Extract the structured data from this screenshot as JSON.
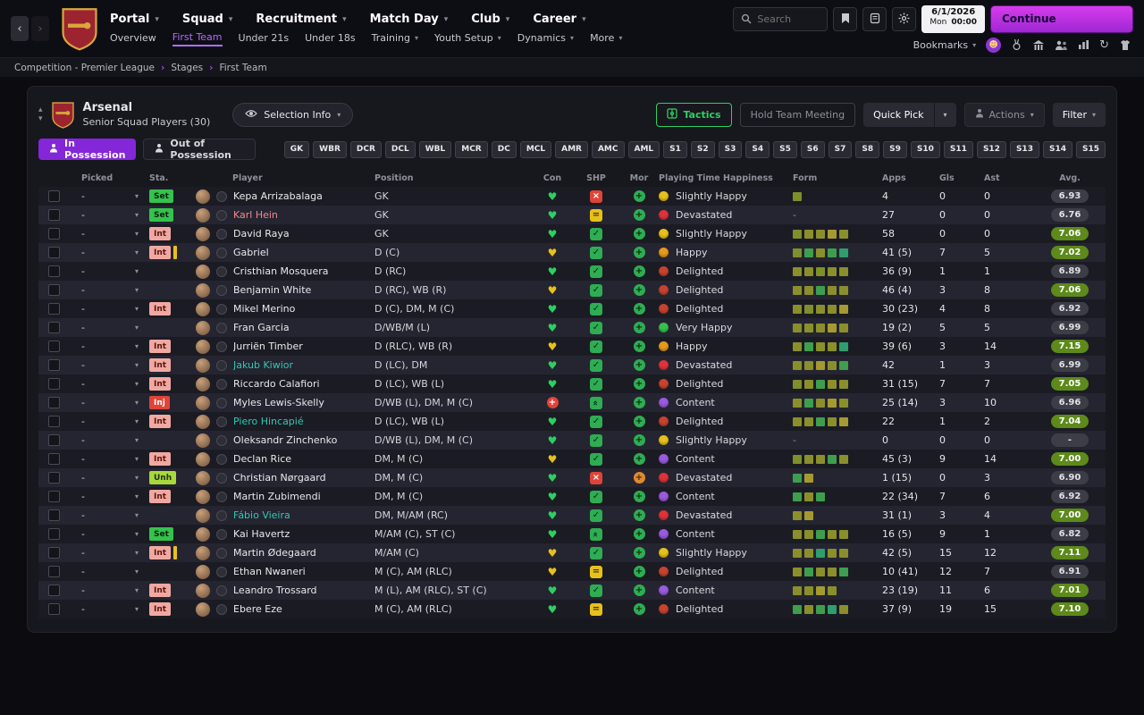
{
  "icons": {
    "chevron_down": "▾",
    "chevron_up": "▴",
    "back": "‹",
    "forward": "›",
    "crumb_sep": "›",
    "check": "✓",
    "cross": "×",
    "equal": "=",
    "plus": "+",
    "heart": "♥",
    "double_up": "»",
    "refresh": "↻"
  },
  "chrome": {
    "nav": [
      {
        "label": "Portal",
        "chevron": true,
        "active": false
      },
      {
        "label": "Squad",
        "chevron": true,
        "active": true
      },
      {
        "label": "Recruitment",
        "chevron": true,
        "active": false
      },
      {
        "label": "Match Day",
        "chevron": true,
        "active": false
      },
      {
        "label": "Club",
        "chevron": true,
        "active": false
      },
      {
        "label": "Career",
        "chevron": true,
        "active": false
      }
    ],
    "subnav": [
      {
        "label": "Overview",
        "chevron": false,
        "active": false
      },
      {
        "label": "First Team",
        "chevron": false,
        "active": true
      },
      {
        "label": "Under 21s",
        "chevron": false,
        "active": false
      },
      {
        "label": "Under 18s",
        "chevron": false,
        "active": false
      },
      {
        "label": "Training",
        "chevron": true,
        "active": false
      },
      {
        "label": "Youth Setup",
        "chevron": true,
        "active": false
      },
      {
        "label": "Dynamics",
        "chevron": true,
        "active": false
      },
      {
        "label": "More",
        "chevron": true,
        "active": false
      }
    ],
    "search_placeholder": "Search",
    "bookmarks_label": "Bookmarks",
    "date": "6/1/2026",
    "day": "Mon",
    "time": "00:00",
    "continue_label": "Continue"
  },
  "breadcrumb": [
    "Competition - Premier League",
    "Stages",
    "First Team"
  ],
  "squad_header": {
    "team": "Arsenal",
    "subtitle": "Senior Squad Players (30)",
    "selection_info": "Selection Info",
    "tactics": "Tactics",
    "hold_meeting": "Hold Team Meeting",
    "quick_pick": "Quick Pick",
    "actions": "Actions",
    "filter": "Filter"
  },
  "possession_tabs": [
    {
      "label": "In Possession",
      "active": true
    },
    {
      "label": "Out of Possession",
      "active": false
    }
  ],
  "position_filters": [
    "GK",
    "WBR",
    "DCR",
    "DCL",
    "WBL",
    "MCR",
    "DC",
    "MCL",
    "AMR",
    "AMC",
    "AML",
    "S1",
    "S2",
    "S3",
    "S4",
    "S5",
    "S6",
    "S7",
    "S8",
    "S9",
    "S10",
    "S11",
    "S12",
    "S13",
    "S14",
    "S15"
  ],
  "table": {
    "picked_placeholder": "-",
    "columns": [
      "",
      "Picked",
      "Sta.",
      "Player",
      "Position",
      "Con",
      "SHP",
      "Mor",
      "Playing Time Happiness",
      "Form",
      "Apps",
      "Gls",
      "Ast",
      "Avg."
    ],
    "players": [
      {
        "status": "Set",
        "status_type": "set",
        "bar": false,
        "name": "Kepa Arrizabalaga",
        "name_color": "default",
        "position": "GK",
        "con": "hg",
        "shp": "cross",
        "mor": "plus",
        "happiness": "Slightly Happy",
        "happiness_color": "#e7c11a",
        "form": [
          "#7e8f2b"
        ],
        "apps": "4",
        "gls": "0",
        "ast": "0",
        "avg": "6.93",
        "avg_good": false
      },
      {
        "status": "Set",
        "status_type": "set",
        "bar": false,
        "name": "Karl Hein",
        "name_color": "loan",
        "position": "GK",
        "con": "hg",
        "shp": "equal",
        "mor": "plus",
        "happiness": "Devastated",
        "happiness_color": "#e03238",
        "form": [],
        "apps": "27",
        "gls": "0",
        "ast": "0",
        "avg": "6.76",
        "avg_good": false
      },
      {
        "status": "Int",
        "status_type": "int",
        "bar": false,
        "name": "David Raya",
        "name_color": "default",
        "position": "GK",
        "con": "hg",
        "shp": "check",
        "mor": "plus",
        "happiness": "Slightly Happy",
        "happiness_color": "#e7c11a",
        "form": [
          "#7e8f2b",
          "#8a8f2c",
          "#8a8f2c",
          "#a59a30",
          "#8a8f2c"
        ],
        "apps": "58",
        "gls": "0",
        "ast": "0",
        "avg": "7.06",
        "avg_good": true
      },
      {
        "status": "Int",
        "status_type": "int",
        "bar": true,
        "name": "Gabriel",
        "name_color": "default",
        "position": "D (C)",
        "con": "hy",
        "shp": "check",
        "mor": "plus",
        "happiness": "Happy",
        "happiness_color": "#e79a1a",
        "form": [
          "#7e8f2b",
          "#3e9e4e",
          "#8a8f2c",
          "#3e9e4e",
          "#2e9e6e"
        ],
        "apps": "41 (5)",
        "gls": "7",
        "ast": "5",
        "avg": "7.02",
        "avg_good": true
      },
      {
        "status": "",
        "status_type": "",
        "bar": false,
        "name": "Cristhian Mosquera",
        "name_color": "default",
        "position": "D (RC)",
        "con": "hg",
        "shp": "check",
        "mor": "plus",
        "happiness": "Delighted",
        "happiness_color": "#c7432e",
        "form": [
          "#8a8f2c",
          "#8a8f2c",
          "#7e8f2b",
          "#8a8f2c",
          "#8a8f2c"
        ],
        "apps": "36 (9)",
        "gls": "1",
        "ast": "1",
        "avg": "6.89",
        "avg_good": false
      },
      {
        "status": "",
        "status_type": "",
        "bar": false,
        "name": "Benjamin White",
        "name_color": "default",
        "position": "D (RC), WB (R)",
        "con": "hy",
        "shp": "check",
        "mor": "plus",
        "happiness": "Delighted",
        "happiness_color": "#c7432e",
        "form": [
          "#8a8f2c",
          "#8a8f2c",
          "#3e9e4e",
          "#8a8f2c",
          "#8a8f2c"
        ],
        "apps": "46 (4)",
        "gls": "3",
        "ast": "8",
        "avg": "7.06",
        "avg_good": true
      },
      {
        "status": "Int",
        "status_type": "int",
        "bar": false,
        "name": "Mikel Merino",
        "name_color": "default",
        "position": "D (C), DM, M (C)",
        "con": "hg",
        "shp": "check",
        "mor": "plus",
        "happiness": "Delighted",
        "happiness_color": "#c7432e",
        "form": [
          "#8a8f2c",
          "#7e8f2b",
          "#8a8f2c",
          "#8a8f2c",
          "#a59a30"
        ],
        "apps": "30 (23)",
        "gls": "4",
        "ast": "8",
        "avg": "6.92",
        "avg_good": false
      },
      {
        "status": "",
        "status_type": "",
        "bar": false,
        "name": "Fran Garcia",
        "name_color": "default",
        "position": "D/WB/M (L)",
        "con": "hg",
        "shp": "check",
        "mor": "plus",
        "happiness": "Very Happy",
        "happiness_color": "#35c24d",
        "form": [
          "#8a8f2c",
          "#8a8f2c",
          "#8a8f2c",
          "#a59a30",
          "#8a8f2c"
        ],
        "apps": "19 (2)",
        "gls": "5",
        "ast": "5",
        "avg": "6.99",
        "avg_good": false
      },
      {
        "status": "Int",
        "status_type": "int",
        "bar": false,
        "name": "Jurriën Timber",
        "name_color": "default",
        "position": "D (RLC), WB (R)",
        "con": "hy",
        "shp": "check",
        "mor": "plus",
        "happiness": "Happy",
        "happiness_color": "#e79a1a",
        "form": [
          "#8a8f2c",
          "#3e9e4e",
          "#8a8f2c",
          "#8a8f2c",
          "#2e9e6e"
        ],
        "apps": "39 (6)",
        "gls": "3",
        "ast": "14",
        "avg": "7.15",
        "avg_good": true
      },
      {
        "status": "Int",
        "status_type": "int",
        "bar": false,
        "name": "Jakub Kiwior",
        "name_color": "teal",
        "position": "D (LC), DM",
        "con": "hg",
        "shp": "check",
        "mor": "plus",
        "happiness": "Devastated",
        "happiness_color": "#e03238",
        "form": [
          "#8a8f2c",
          "#8a8f2c",
          "#a59a30",
          "#8a8f2c",
          "#3e9e4e"
        ],
        "apps": "42",
        "gls": "1",
        "ast": "3",
        "avg": "6.99",
        "avg_good": false
      },
      {
        "status": "Int",
        "status_type": "int",
        "bar": false,
        "name": "Riccardo Calafiori",
        "name_color": "default",
        "position": "D (LC), WB (L)",
        "con": "hg",
        "shp": "check",
        "mor": "plus",
        "happiness": "Delighted",
        "happiness_color": "#c7432e",
        "form": [
          "#7e8f2b",
          "#8a8f2c",
          "#3e9e4e",
          "#8a8f2c",
          "#8a8f2c"
        ],
        "apps": "31 (15)",
        "gls": "7",
        "ast": "7",
        "avg": "7.05",
        "avg_good": true
      },
      {
        "status": "Inj",
        "status_type": "inj",
        "bar": false,
        "name": "Myles Lewis-Skelly",
        "name_color": "default",
        "position": "D/WB (L), DM, M (C)",
        "con": "cross",
        "shp": "up",
        "mor": "plus",
        "happiness": "Content",
        "happiness_color": "#9a5ae0",
        "form": [
          "#8a8f2c",
          "#3e9e4e",
          "#8a8f2c",
          "#a59a30",
          "#8a8f2c"
        ],
        "apps": "25 (14)",
        "gls": "3",
        "ast": "10",
        "avg": "6.96",
        "avg_good": false
      },
      {
        "status": "Int",
        "status_type": "int",
        "bar": false,
        "name": "Piero Hincapié",
        "name_color": "teal",
        "position": "D (LC), WB (L)",
        "con": "hg",
        "shp": "check",
        "mor": "plus",
        "happiness": "Delighted",
        "happiness_color": "#c7432e",
        "form": [
          "#8a8f2c",
          "#8a8f2c",
          "#3e9e4e",
          "#8a8f2c",
          "#a59a30"
        ],
        "apps": "22",
        "gls": "1",
        "ast": "2",
        "avg": "7.04",
        "avg_good": true
      },
      {
        "status": "",
        "status_type": "",
        "bar": false,
        "name": "Oleksandr Zinchenko",
        "name_color": "default",
        "position": "D/WB (L), DM, M (C)",
        "con": "hg",
        "shp": "check",
        "mor": "plus",
        "happiness": "Slightly Happy",
        "happiness_color": "#e7c11a",
        "form": [],
        "apps": "0",
        "gls": "0",
        "ast": "0",
        "avg": "-",
        "avg_good": false
      },
      {
        "status": "Int",
        "status_type": "int",
        "bar": false,
        "name": "Declan Rice",
        "name_color": "default",
        "position": "DM, M (C)",
        "con": "hy",
        "shp": "check",
        "mor": "plus",
        "happiness": "Content",
        "happiness_color": "#9a5ae0",
        "form": [
          "#7e8f2b",
          "#8a8f2c",
          "#8a8f2c",
          "#3e9e4e",
          "#8a8f2c"
        ],
        "apps": "45 (3)",
        "gls": "9",
        "ast": "14",
        "avg": "7.00",
        "avg_good": true
      },
      {
        "status": "Unh",
        "status_type": "unh",
        "bar": false,
        "name": "Christian Nørgaard",
        "name_color": "default",
        "position": "DM, M (C)",
        "con": "hg",
        "shp": "cross",
        "mor": "dot",
        "happiness": "Devastated",
        "happiness_color": "#e03238",
        "form": [
          "#3e9e4e",
          "#a59a30"
        ],
        "apps": "1 (15)",
        "gls": "0",
        "ast": "3",
        "avg": "6.90",
        "avg_good": false
      },
      {
        "status": "Int",
        "status_type": "int",
        "bar": false,
        "name": "Martin Zubimendi",
        "name_color": "default",
        "position": "DM, M (C)",
        "con": "hg",
        "shp": "check",
        "mor": "plus",
        "happiness": "Content",
        "happiness_color": "#9a5ae0",
        "form": [
          "#3e9e4e",
          "#8a8f2c",
          "#3e9e4e"
        ],
        "apps": "22 (34)",
        "gls": "7",
        "ast": "6",
        "avg": "6.92",
        "avg_good": false
      },
      {
        "status": "",
        "status_type": "",
        "bar": false,
        "name": "Fábio Vieira",
        "name_color": "teal",
        "position": "DM, M/AM (RC)",
        "con": "hg",
        "shp": "check",
        "mor": "plus",
        "happiness": "Devastated",
        "happiness_color": "#e03238",
        "form": [
          "#8a8f2c",
          "#a59a30"
        ],
        "apps": "31 (1)",
        "gls": "3",
        "ast": "4",
        "avg": "7.00",
        "avg_good": true
      },
      {
        "status": "Set",
        "status_type": "set",
        "bar": false,
        "name": "Kai Havertz",
        "name_color": "default",
        "position": "M/AM (C), ST (C)",
        "con": "hg",
        "shp": "up",
        "mor": "plus",
        "happiness": "Content",
        "happiness_color": "#9a5ae0",
        "form": [
          "#8a8f2c",
          "#8a8f2c",
          "#3e9e4e",
          "#8a8f2c",
          "#8a8f2c"
        ],
        "apps": "16 (5)",
        "gls": "9",
        "ast": "1",
        "avg": "6.82",
        "avg_good": false
      },
      {
        "status": "Int",
        "status_type": "int",
        "bar": true,
        "name": "Martin Ødegaard",
        "name_color": "default",
        "position": "M/AM (C)",
        "con": "hy",
        "shp": "check",
        "mor": "plus",
        "happiness": "Slightly Happy",
        "happiness_color": "#e7c11a",
        "form": [
          "#8a8f2c",
          "#8a8f2c",
          "#2e9e6e",
          "#8a8f2c",
          "#8a8f2c"
        ],
        "apps": "42 (5)",
        "gls": "15",
        "ast": "12",
        "avg": "7.11",
        "avg_good": true
      },
      {
        "status": "",
        "status_type": "",
        "bar": false,
        "name": "Ethan Nwaneri",
        "name_color": "default",
        "position": "M (C), AM (RLC)",
        "con": "hy",
        "shp": "equal",
        "mor": "plus",
        "happiness": "Delighted",
        "happiness_color": "#c7432e",
        "form": [
          "#8a8f2c",
          "#3e9e4e",
          "#8a8f2c",
          "#8a8f2c",
          "#3e9e4e"
        ],
        "apps": "10 (41)",
        "gls": "12",
        "ast": "7",
        "avg": "6.91",
        "avg_good": false
      },
      {
        "status": "Int",
        "status_type": "int",
        "bar": false,
        "name": "Leandro Trossard",
        "name_color": "default",
        "position": "M (L), AM (RLC), ST (C)",
        "con": "hg",
        "shp": "check",
        "mor": "plus",
        "happiness": "Content",
        "happiness_color": "#9a5ae0",
        "form": [
          "#8a8f2c",
          "#8a8f2c",
          "#a59a30",
          "#8a8f2c"
        ],
        "apps": "23 (19)",
        "gls": "11",
        "ast": "6",
        "avg": "7.01",
        "avg_good": true
      },
      {
        "status": "Int",
        "status_type": "int",
        "bar": false,
        "name": "Ebere Eze",
        "name_color": "default",
        "position": "M (C), AM (RLC)",
        "con": "hg",
        "shp": "equal",
        "mor": "plus",
        "happiness": "Delighted",
        "happiness_color": "#c7432e",
        "form": [
          "#3e9e4e",
          "#8a8f2c",
          "#3e9e4e",
          "#2e9e6e",
          "#8a8f2c"
        ],
        "apps": "37 (9)",
        "gls": "19",
        "ast": "15",
        "avg": "7.10",
        "avg_good": true
      }
    ]
  }
}
